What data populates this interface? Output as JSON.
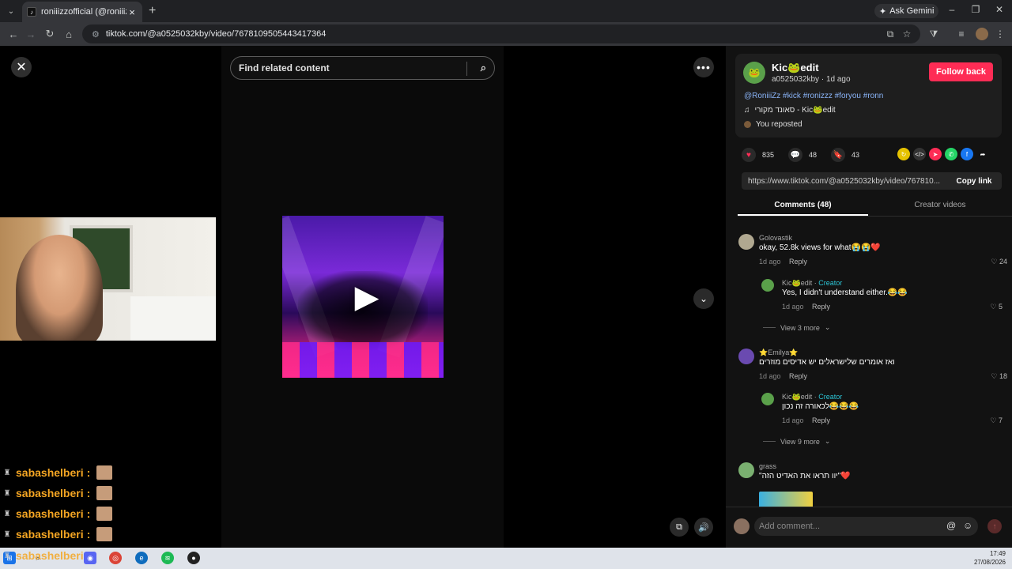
{
  "browser": {
    "tab_title": "roniiizzofficial (@roniiizzofficial)",
    "new_tab_symbol": "+",
    "ask_gemini": "Ask Gemini",
    "url": "tiktok.com/@a0525032kby/video/7678109505443417364"
  },
  "player": {
    "search_placeholder": "Find related content"
  },
  "chat_overlay": {
    "lines": [
      {
        "name": "sabashelberi",
        "sep": ":"
      },
      {
        "name": "sabashelberi",
        "sep": ":"
      },
      {
        "name": "sabashelberi",
        "sep": ":"
      },
      {
        "name": "sabashelberi",
        "sep": ":"
      },
      {
        "name": "sabashelberi",
        "sep": ""
      }
    ]
  },
  "post": {
    "author_name": "Kic🐸edit",
    "author_meta": "a0525032kby · 1d ago",
    "follow_label": "Follow back",
    "description": "@RoniiiZz #kick #ronizzz #foryou #ronn",
    "music": "סאונד מקורי - Kic🐸edit",
    "repost_text": "You reposted",
    "likes": "835",
    "comments": "48",
    "saves": "43",
    "share_link": "https://www.tiktok.com/@a0525032kby/video/767810...",
    "copy_link_label": "Copy link"
  },
  "tabs": {
    "comments": "Comments (48)",
    "creator_videos": "Creator videos"
  },
  "comments": [
    {
      "user": "Golovastik",
      "text": "okay, 52.8k views for what😭😭❤️",
      "time": "1d ago",
      "reply": "Reply",
      "likes": "24"
    },
    {
      "user": "Kic🐸edit",
      "creator": "Creator",
      "text": "Yes, I didn't understand either.😂😂",
      "time": "1d ago",
      "reply": "Reply",
      "likes": "5"
    },
    {
      "view_more": "View 3 more"
    },
    {
      "user": "⭐Emilya⭐",
      "text": "ואז אומרים שלישראלים יש אדיסים מוזרים",
      "time": "1d ago",
      "reply": "Reply",
      "likes": "18"
    },
    {
      "user": "Kic🐸edit",
      "creator": "Creator",
      "text": "לכאורה זה נכון😂😂😂",
      "time": "1d ago",
      "reply": "Reply",
      "likes": "7"
    },
    {
      "view_more": "View 9 more"
    },
    {
      "user": "grass",
      "text": "\"יוו תראו את האדיט הזה\"❤️"
    }
  ],
  "comment_bar": {
    "placeholder": "Add comment..."
  },
  "taskbar": {
    "time": "17:49",
    "date": "27/08/2026"
  },
  "colors": {
    "accent": "#fe2c55",
    "creator": "#2bc3d4",
    "chat_name": "#f5a623"
  }
}
